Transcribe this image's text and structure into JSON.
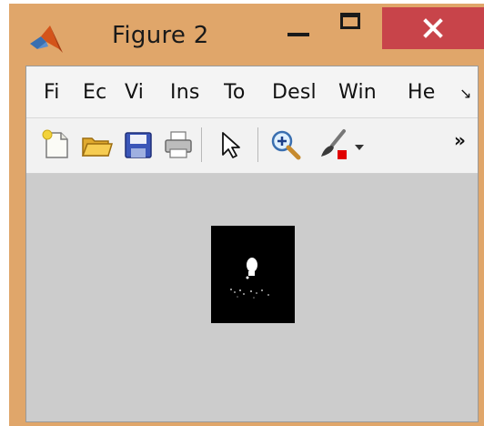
{
  "window": {
    "title": "Figure 2",
    "frame_color": "#e0a66a",
    "close_color": "#c8444a"
  },
  "icons": {
    "app": "matlab-logo-icon",
    "minimize": "minimize-icon",
    "maximize": "maximize-icon",
    "close": "close-icon"
  },
  "menubar": {
    "items": [
      "Fi",
      "Ec",
      "Vi",
      "Ins",
      "To",
      "Desl",
      "Win",
      "He"
    ],
    "overflow_icon": "menu-overflow-arrow-icon"
  },
  "toolbar": {
    "tools": [
      "new-figure-icon",
      "open-file-icon",
      "save-icon",
      "print-icon",
      "pointer-icon",
      "zoom-in-icon",
      "brush-icon",
      "dropdown-arrow-icon"
    ],
    "overflow_icon": "toolbar-overflow-chevrons-icon",
    "brush_color": "#e00000"
  },
  "canvas": {
    "background": "#cccccc",
    "image_background": "#000000"
  }
}
